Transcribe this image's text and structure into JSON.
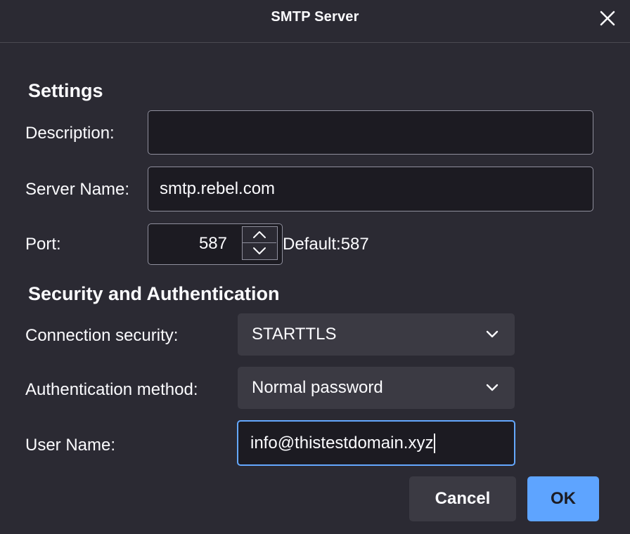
{
  "window": {
    "title": "SMTP Server",
    "close_icon": "close-icon"
  },
  "settings": {
    "heading": "Settings",
    "description_label": "Description:",
    "description_value": "",
    "server_name_label": "Server Name:",
    "server_name_value": "smtp.rebel.com",
    "port_label": "Port:",
    "port_value": "587",
    "port_default_text": "Default:587",
    "port_spinner_icons": [
      "chevron-up-icon",
      "chevron-down-icon"
    ]
  },
  "security": {
    "heading": "Security and Authentication",
    "connection_security_label": "Connection security:",
    "connection_security_value": "STARTTLS",
    "auth_method_label": "Authentication method:",
    "auth_method_value": "Normal password",
    "user_name_label": "User Name:",
    "user_name_value": "info@thistestdomain.xyz"
  },
  "buttons": {
    "cancel": "Cancel",
    "ok": "OK"
  },
  "colors": {
    "background": "#2b2a33",
    "input_background": "#1c1b22",
    "select_background": "#3b3a43",
    "focus_accent": "#64a8ff",
    "primary_button": "#5ea4ff"
  }
}
